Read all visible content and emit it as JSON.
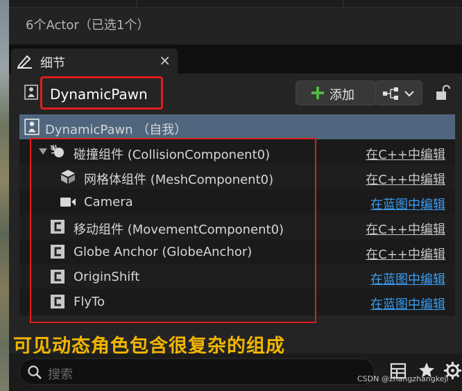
{
  "header": {
    "actor_count": "6个Actor（已选1个）"
  },
  "tab": {
    "label": "细节",
    "close": "×"
  },
  "actor": {
    "name": "DynamicPawn"
  },
  "toolbar": {
    "add_label": "添加"
  },
  "tree": {
    "root": {
      "label": "DynamicPawn （自我）"
    },
    "items": [
      {
        "label": "碰撞组件 (CollisionComponent0)",
        "edit": "在C++中编辑",
        "edit_type": "cpp",
        "icon": "collision-icon"
      },
      {
        "label": "网格体组件 (MeshComponent0)",
        "edit": "在C++中编辑",
        "edit_type": "cpp",
        "icon": "mesh-icon"
      },
      {
        "label": "Camera",
        "edit": "在蓝图中编辑",
        "edit_type": "blueprint",
        "icon": "camera-icon"
      },
      {
        "label": "移动组件 (MovementComponent0)",
        "edit": "在C++中编辑",
        "edit_type": "cpp",
        "icon": "component-c-icon"
      },
      {
        "label": "Globe Anchor (GlobeAnchor)",
        "edit": "在C++中编辑",
        "edit_type": "cpp",
        "icon": "component-c-icon"
      },
      {
        "label": "OriginShift",
        "edit": "在蓝图中编辑",
        "edit_type": "blueprint",
        "icon": "component-c-icon"
      },
      {
        "label": "FlyTo",
        "edit": "在蓝图中编辑",
        "edit_type": "blueprint",
        "icon": "component-c-icon"
      }
    ]
  },
  "annotation": {
    "caption": "可见动态角色包含很复杂的组成"
  },
  "search": {
    "placeholder": "搜索"
  },
  "watermark": "CSDN @zhangzhangkeji",
  "colors": {
    "selected_row": "#4f667e",
    "annotation_red": "#e11d1d",
    "caption_yellow": "#f2b600",
    "blueprint_link": "#3b9cf0",
    "add_plus": "#52b848"
  }
}
